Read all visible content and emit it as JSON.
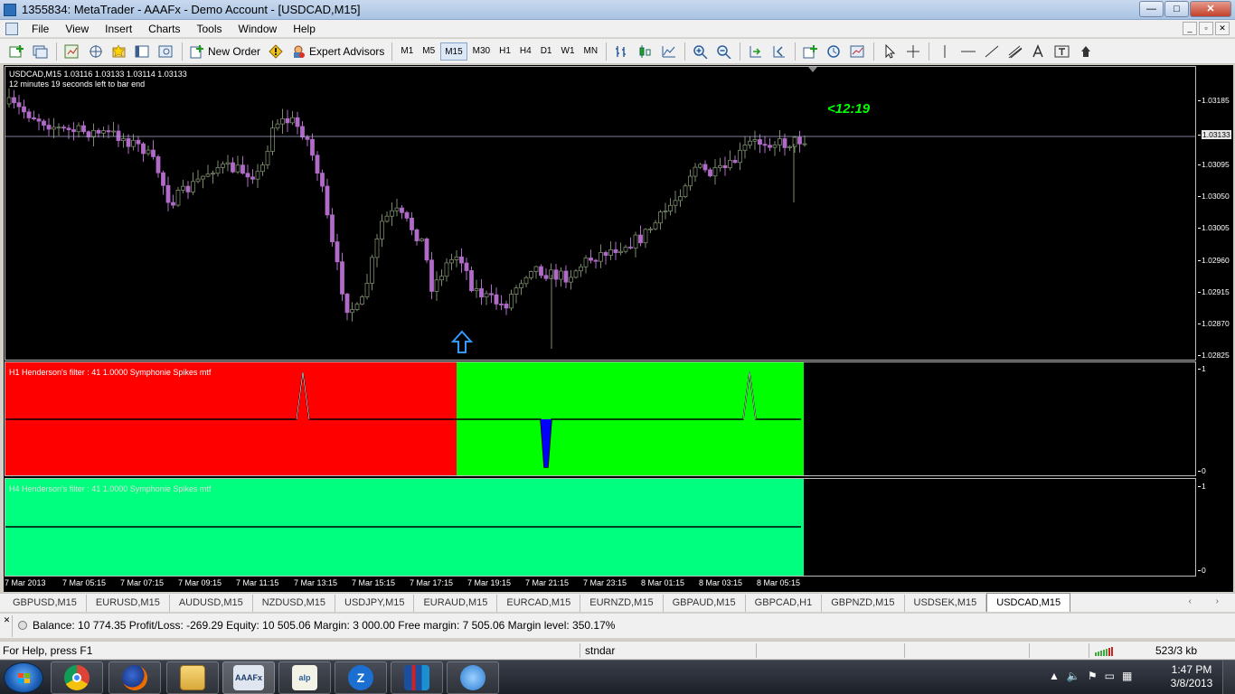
{
  "window": {
    "title": "1355834: MetaTrader - AAAFx - Demo Account - [USDCAD,M15]",
    "buttons": {
      "minimize": "—",
      "maximize": "□",
      "close": "✕"
    }
  },
  "menu": {
    "items": [
      "File",
      "View",
      "Insert",
      "Charts",
      "Tools",
      "Window",
      "Help"
    ],
    "mdi_buttons": [
      "_",
      "▫",
      "✕"
    ]
  },
  "toolbar": {
    "new_order": "New Order",
    "expert_advisors": "Expert Advisors",
    "timeframes": [
      "M1",
      "M5",
      "M15",
      "M30",
      "H1",
      "H4",
      "D1",
      "W1",
      "MN"
    ],
    "active_timeframe": "M15"
  },
  "chart": {
    "symbol_info": "USDCAD,M15  1.03116 1.03133 1.03114 1.03133",
    "bar_timer_text": "12 minutes 19 seconds left to bar end",
    "countdown": "<12:19",
    "price_labels": [
      "1.03185",
      "1.03133",
      "1.03095",
      "1.03050",
      "1.03005",
      "1.02960",
      "1.02915",
      "1.02870",
      "1.02825"
    ],
    "current_price": "1.03133",
    "time_labels": [
      "7 Mar 2013",
      "7 Mar 05:15",
      "7 Mar 07:15",
      "7 Mar 09:15",
      "7 Mar 11:15",
      "7 Mar 13:15",
      "7 Mar 15:15",
      "7 Mar 17:15",
      "7 Mar 19:15",
      "7 Mar 21:15",
      "7 Mar 23:15",
      "8 Mar 01:15",
      "8 Mar 03:15",
      "8 Mar 05:15"
    ],
    "colors": {
      "bull": "#7a8a6a",
      "bear": "#b06ac8",
      "bg": "#000000",
      "arrow": "#3399ff",
      "red_zone": "#ff0000",
      "green_zone": "#00ff00",
      "h4_zone": "#00ff7f"
    }
  },
  "indicators": {
    "h1": {
      "label": "H1 Henderson's filter : 41 1.0000  Symphonie Spikes mtf",
      "scale_top": "1",
      "scale_bottom": "0"
    },
    "h4": {
      "label": "H4 Henderson's filter : 41 1.0000  Symphonie Spikes mtf",
      "scale_top": "1",
      "scale_bottom": "0"
    }
  },
  "tabs": {
    "items": [
      "GBPUSD,M15",
      "EURUSD,M15",
      "AUDUSD,M15",
      "NZDUSD,M15",
      "USDJPY,M15",
      "EURAUD,M15",
      "EURCAD,M15",
      "EURNZD,M15",
      "GBPAUD,M15",
      "GBPCAD,H1",
      "GBPNZD,M15",
      "USDSEK,M15",
      "USDCAD,M15"
    ],
    "active": "USDCAD,M15",
    "arrows": "‹ ›"
  },
  "account": {
    "summary": "Balance: 10 774.35  Profit/Loss: -269.29  Equity: 10 505.06  Margin: 3 000.00  Free margin: 7 505.06  Margin level: 350.17%",
    "side_label": "✕"
  },
  "status": {
    "help": "For Help, press F1",
    "profile": "stndar",
    "traffic": "523/3 kb"
  },
  "taskbar": {
    "apps": [
      {
        "name": "chrome",
        "label": ""
      },
      {
        "name": "firefox",
        "label": ""
      },
      {
        "name": "explorer",
        "label": ""
      },
      {
        "name": "metatrader-aaafx",
        "label": "AAAFx"
      },
      {
        "name": "alp",
        "label": "alp"
      },
      {
        "name": "app-z",
        "label": "Z"
      },
      {
        "name": "app-chart",
        "label": ""
      },
      {
        "name": "app-chat",
        "label": ""
      }
    ],
    "time": "1:47 PM",
    "date": "3/8/2013"
  }
}
